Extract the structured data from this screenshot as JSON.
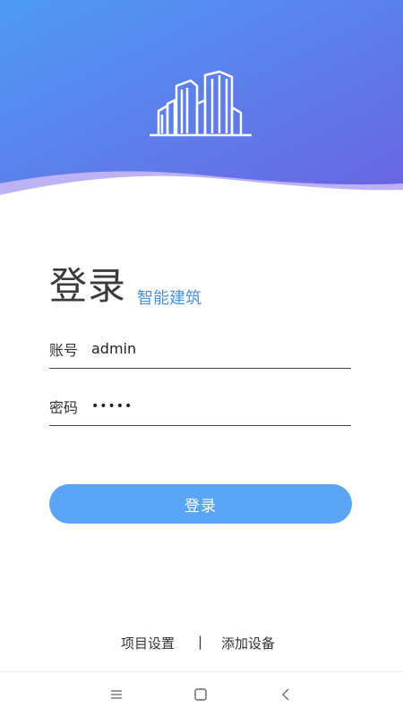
{
  "header": {
    "gradient_start": "#4e9cf5",
    "gradient_end": "#6b63e0",
    "wave_color": "#c8b8f4",
    "logo_icon": "city-buildings-icon"
  },
  "title": {
    "main": "登录",
    "sub": "智能建筑"
  },
  "form": {
    "account_label": "账号",
    "account_value": "admin",
    "password_label": "密码",
    "password_value": "•••••"
  },
  "login_button": {
    "label": "登录",
    "color": "#5aa4f5"
  },
  "footer": {
    "project_settings": "项目设置",
    "divider": "|",
    "add_device": "添加设备"
  },
  "navbar": {
    "icons": [
      "menu-icon",
      "home-square-icon",
      "back-chevron-icon"
    ]
  }
}
